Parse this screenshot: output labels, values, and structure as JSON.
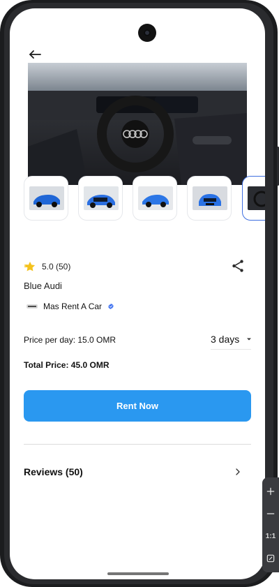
{
  "product": {
    "rating_text": "5.0 (50)",
    "title": "Blue Audi",
    "provider_name": "Mas Rent A Car",
    "price_per_day_text": "Price per day: 15.0 OMR",
    "days_value": "3 days",
    "total_price_text": "Total Price: 45.0 OMR",
    "rent_button_label": "Rent Now",
    "reviews_label": "Reviews (50)"
  },
  "thumbnails": [
    {
      "caption": "blue-audi-side"
    },
    {
      "caption": "blue-audi-front-left"
    },
    {
      "caption": "blue-audi-front-right"
    },
    {
      "caption": "blue-audi-front"
    },
    {
      "caption": "interior-dashboard"
    }
  ],
  "side_tools": {
    "aspect_label": "1:1"
  },
  "colors": {
    "accent": "#2a98f0",
    "star": "#f4c21d",
    "verified": "#3b6ff0"
  },
  "icons": {
    "back": "arrow-left-icon",
    "share": "share-icon",
    "chevron": "chevron-right-icon",
    "star": "star-icon",
    "dropdown": "caret-down-icon",
    "verified": "verified-badge-icon"
  }
}
